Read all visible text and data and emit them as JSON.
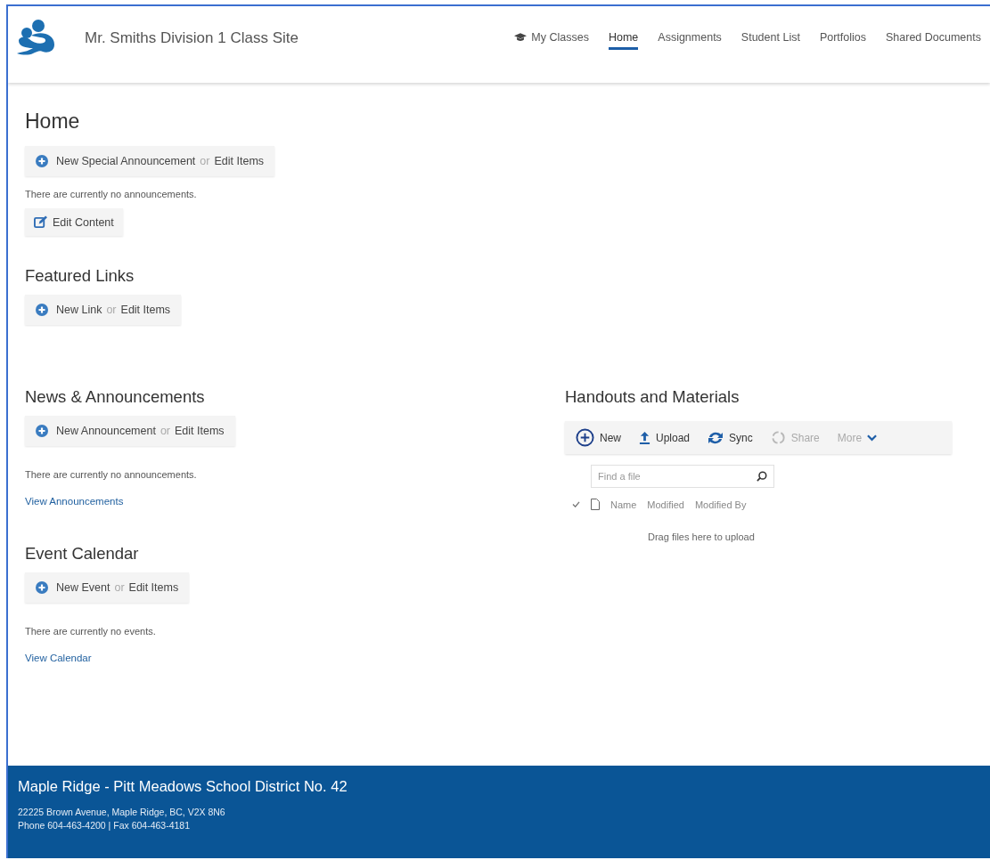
{
  "header": {
    "site_title": "Mr. Smiths Division 1 Class Site",
    "nav": [
      {
        "label": "My Classes",
        "kind": "icon",
        "selected": false
      },
      {
        "label": "Home",
        "kind": "plain",
        "selected": true
      },
      {
        "label": "Assignments",
        "kind": "plain",
        "selected": false
      },
      {
        "label": "Student List",
        "kind": "plain",
        "selected": false
      },
      {
        "label": "Portfolios",
        "kind": "plain",
        "selected": false
      },
      {
        "label": "Shared Documents",
        "kind": "plain",
        "selected": false
      }
    ]
  },
  "page_title": "Home",
  "home": {
    "action": {
      "new_label": "New Special Announcement",
      "or": "or",
      "edit_label": "Edit Items"
    },
    "empty_text": "There are currently no announcements.",
    "edit_button": "Edit Content"
  },
  "featured_links": {
    "title": "Featured Links",
    "action": {
      "new_label": "New Link",
      "or": "or",
      "edit_label": "Edit Items"
    }
  },
  "news": {
    "title": "News & Announcements",
    "action": {
      "new_label": "New Announcement",
      "or": "or",
      "edit_label": "Edit Items"
    },
    "empty_text": "There are currently no announcements.",
    "view_link": "View Announcements"
  },
  "events": {
    "title": "Event Calendar",
    "action": {
      "new_label": "New Event",
      "or": "or",
      "edit_label": "Edit Items"
    },
    "empty_text": "There are currently no events.",
    "view_link": "View Calendar"
  },
  "handouts": {
    "title": "Handouts and Materials",
    "toolbar": [
      {
        "label": "New",
        "kind": "new",
        "disabled": false
      },
      {
        "label": "Upload",
        "kind": "upload",
        "disabled": false
      },
      {
        "label": "Sync",
        "kind": "sync",
        "disabled": false
      },
      {
        "label": "Share",
        "kind": "share",
        "disabled": true
      },
      {
        "label": "More",
        "kind": "more",
        "disabled": true
      }
    ],
    "search": {
      "placeholder": "Find a file"
    },
    "columns": [
      "Name",
      "Modified",
      "Modified By"
    ],
    "drop_text": "Drag files here to upload"
  },
  "footer": {
    "title": "Maple Ridge - Pitt Meadows School District No. 42",
    "address": "22225 Brown Avenue, Maple Ridge, BC, V2X 8N6",
    "contact": "Phone 604-463-4200 | Fax 604-463-4181"
  }
}
